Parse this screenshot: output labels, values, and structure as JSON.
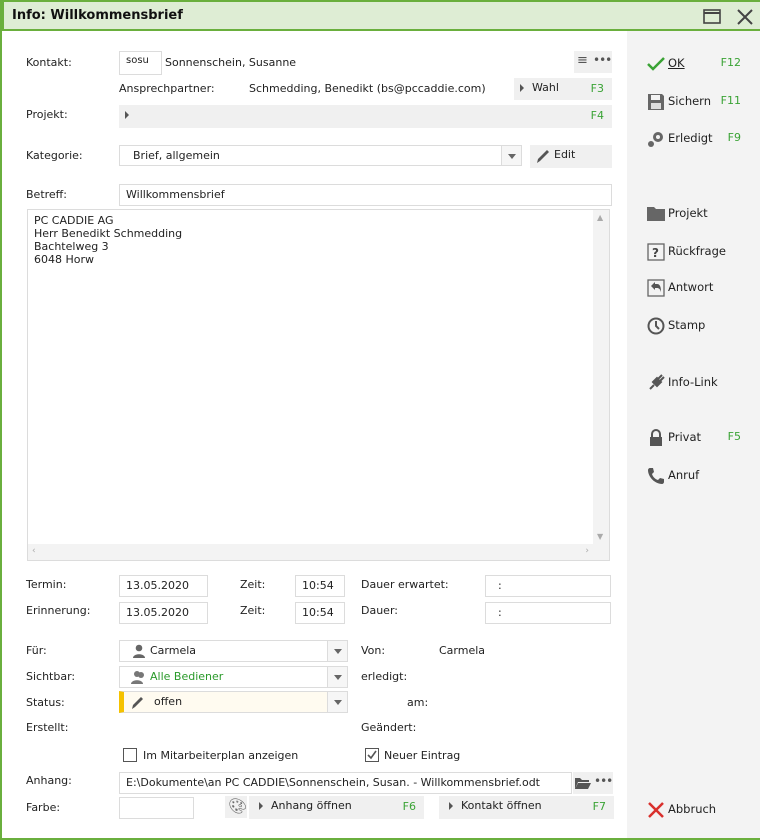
{
  "window": {
    "title": "Info: Willkommensbrief"
  },
  "kontakt": {
    "label": "Kontakt:",
    "code": "sosu",
    "name": "Sonnenschein, Susanne"
  },
  "ansprechpartner": {
    "label": "Ansprechpartner:",
    "value": "Schmedding, Benedikt (bs@pccaddie.com)",
    "wahl_label": "Wahl",
    "wahl_key": "F3"
  },
  "projekt": {
    "label": "Projekt:",
    "key": "F4"
  },
  "kategorie": {
    "label": "Kategorie:",
    "value": "Brief, allgemein",
    "edit_label": "Edit"
  },
  "betreff": {
    "label": "Betreff:",
    "value": "Willkommensbrief"
  },
  "body_text": [
    "PC CADDIE AG",
    "Herr Benedikt Schmedding",
    "Bachtelweg 3",
    "6048  Horw"
  ],
  "termin": {
    "label": "Termin:",
    "date": "13.05.2020",
    "zeit_label": "Zeit:",
    "time": "10:54",
    "dauer_label": "Dauer erwartet:",
    "dauer": ":"
  },
  "erinnerung": {
    "label": "Erinnerung:",
    "date": "13.05.2020",
    "zeit_label": "Zeit:",
    "time": "10:54",
    "dauer_label": "Dauer:",
    "dauer": ":"
  },
  "fuer": {
    "label": "Für:",
    "value": "Carmela"
  },
  "von": {
    "label": "Von:",
    "value": "Carmela"
  },
  "sichtbar": {
    "label": "Sichtbar:",
    "value": "Alle Bediener"
  },
  "erledigt_label": "erledigt:",
  "status": {
    "label": "Status:",
    "value": "offen",
    "color": "#f5c200"
  },
  "am_label": "am:",
  "erstellt_label": "Erstellt:",
  "geaendert_label": "Geändert:",
  "checkbox_mitarbeiterplan": {
    "label": "Im Mitarbeiterplan anzeigen",
    "checked": false
  },
  "checkbox_neuer_eintrag": {
    "label": "Neuer Eintrag",
    "checked": true
  },
  "anhang": {
    "label": "Anhang:",
    "value": "E:\\Dokumente\\an PC CADDIE\\Sonnenschein, Susan. - Willkommensbrief.odt"
  },
  "farbe": {
    "label": "Farbe:"
  },
  "anhang_oeffnen": {
    "label": "Anhang öffnen",
    "key": "F6"
  },
  "kontakt_oeffnen": {
    "label": "Kontakt öffnen",
    "key": "F7"
  },
  "sidebar": [
    {
      "label": "OK",
      "key": "F12"
    },
    {
      "label": "Sichern",
      "key": "F11"
    },
    {
      "label": "Erledigt",
      "key": "F9"
    },
    {
      "label": "Projekt",
      "key": ""
    },
    {
      "label": "Rückfrage",
      "key": ""
    },
    {
      "label": "Antwort",
      "key": ""
    },
    {
      "label": "Stamp",
      "key": ""
    },
    {
      "label": "Info-Link",
      "key": ""
    },
    {
      "label": "Privat",
      "key": "F5"
    },
    {
      "label": "Anruf",
      "key": ""
    },
    {
      "label": "Abbruch",
      "key": ""
    }
  ]
}
